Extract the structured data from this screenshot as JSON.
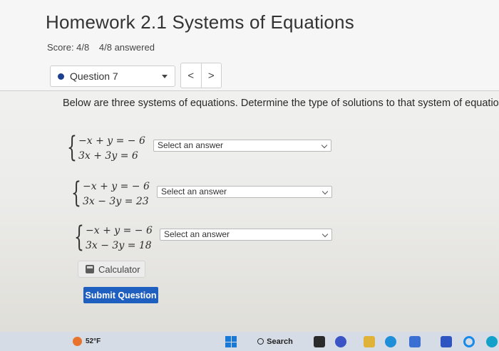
{
  "header": {
    "title": "Homework 2.1 Systems of Equations",
    "score": "Score: 4/8",
    "answered": "4/8 answered"
  },
  "question_nav": {
    "current": "Question 7",
    "prev_symbol": "<",
    "next_symbol": ">"
  },
  "instructions": "Below are three systems of equations. Determine the type of solutions to that system of equations",
  "systems": [
    {
      "eq1": "−x + y = − 6",
      "eq2": "3x + 3y = 6",
      "select": "Select an answer"
    },
    {
      "eq1": "−x + y = − 6",
      "eq2": "3x − 3y = 23",
      "select": "Select an answer"
    },
    {
      "eq1": "−x + y = − 6",
      "eq2": "3x − 3y = 18",
      "select": "Select an answer"
    }
  ],
  "buttons": {
    "calculator": "Calculator",
    "submit": "Submit Question"
  },
  "taskbar": {
    "weather": "52°F",
    "search": "Search"
  },
  "colors": {
    "accent": "#1e5fbf",
    "question_dot": "#1d3f8f"
  }
}
